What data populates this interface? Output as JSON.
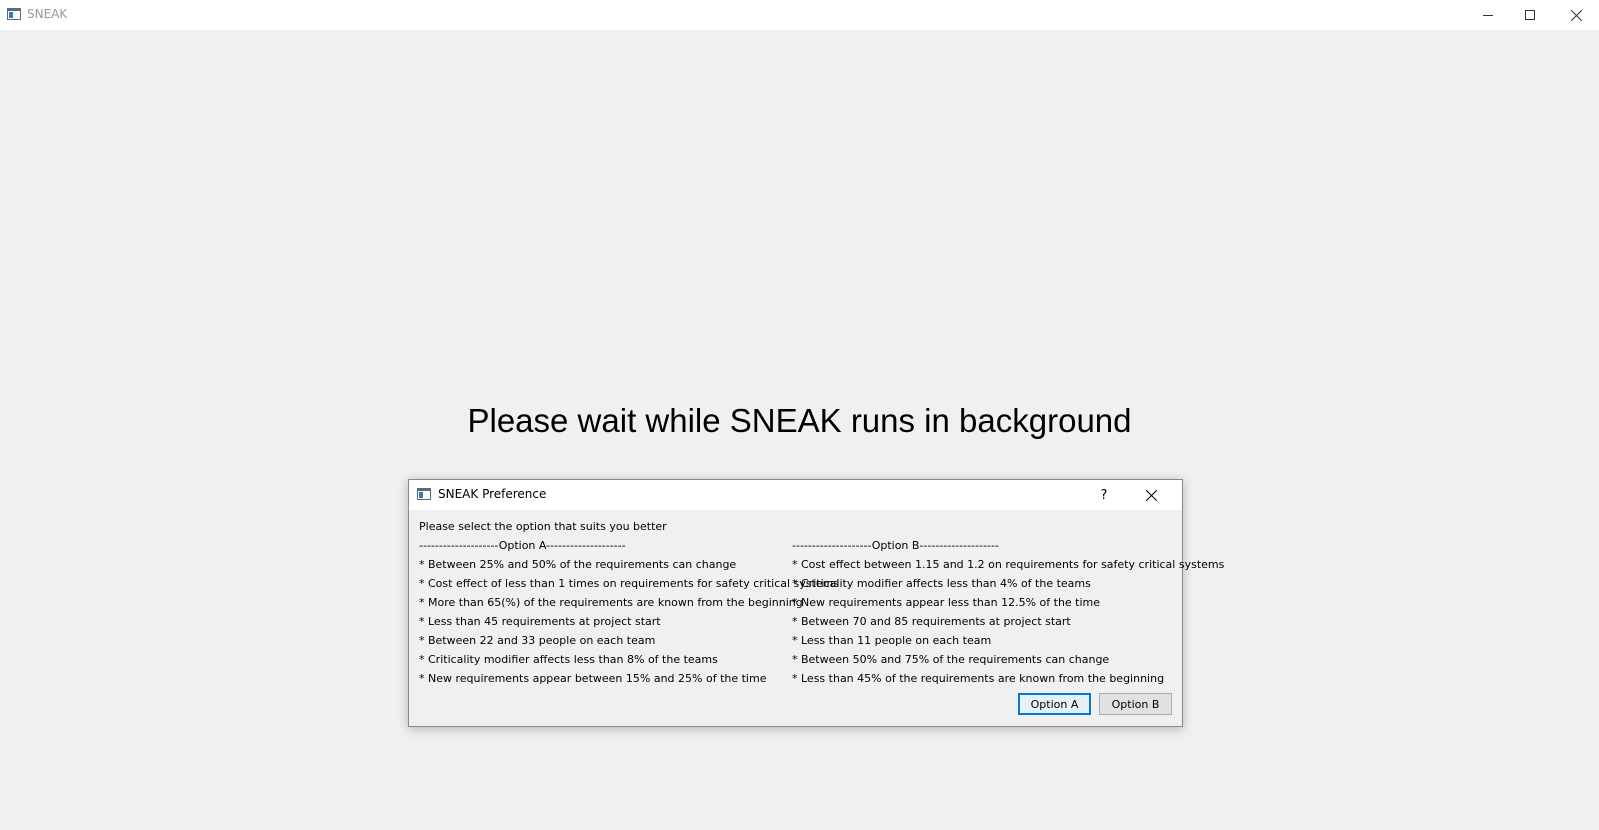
{
  "window": {
    "title": "SNEAK"
  },
  "main": {
    "message": "Please wait while SNEAK runs in background"
  },
  "dialog": {
    "title": "SNEAK Preference",
    "help_label": "?",
    "prompt": "Please select the option that suits you better",
    "option_a": {
      "header": "--------------------Option A--------------------",
      "items": [
        "* Between 25% and 50% of the requirements can change",
        "* Cost effect of less than 1 times on requirements for safety critical systems",
        "* More than 65(%) of the requirements are known from the beginning",
        "* Less than 45 requirements at project start",
        "* Between 22 and 33 people on each team",
        "* Criticality modifier affects less than 8% of the teams",
        "* New requirements appear between 15% and 25% of the time"
      ]
    },
    "option_b": {
      "header": "--------------------Option B--------------------",
      "items": [
        "* Cost effect between 1.15 and 1.2 on requirements for safety critical systems",
        "* Criticality modifier affects less than 4% of the teams",
        "* New requirements appear less than 12.5% of the time",
        "* Between 70 and 85 requirements at project start",
        "* Less than 11 people on each team",
        "* Between 50% and 75% of the requirements can change",
        "* Less than 45% of the requirements are known from the beginning"
      ]
    },
    "buttons": {
      "option_a": "Option A",
      "option_b": "Option B"
    }
  },
  "icons": {
    "app": "app-window-icon",
    "minimize": "minimize-icon",
    "maximize": "maximize-icon",
    "close": "close-icon"
  },
  "colors": {
    "background": "#f0f0f0",
    "titlebar": "#ffffff",
    "accent": "#0078d7"
  }
}
